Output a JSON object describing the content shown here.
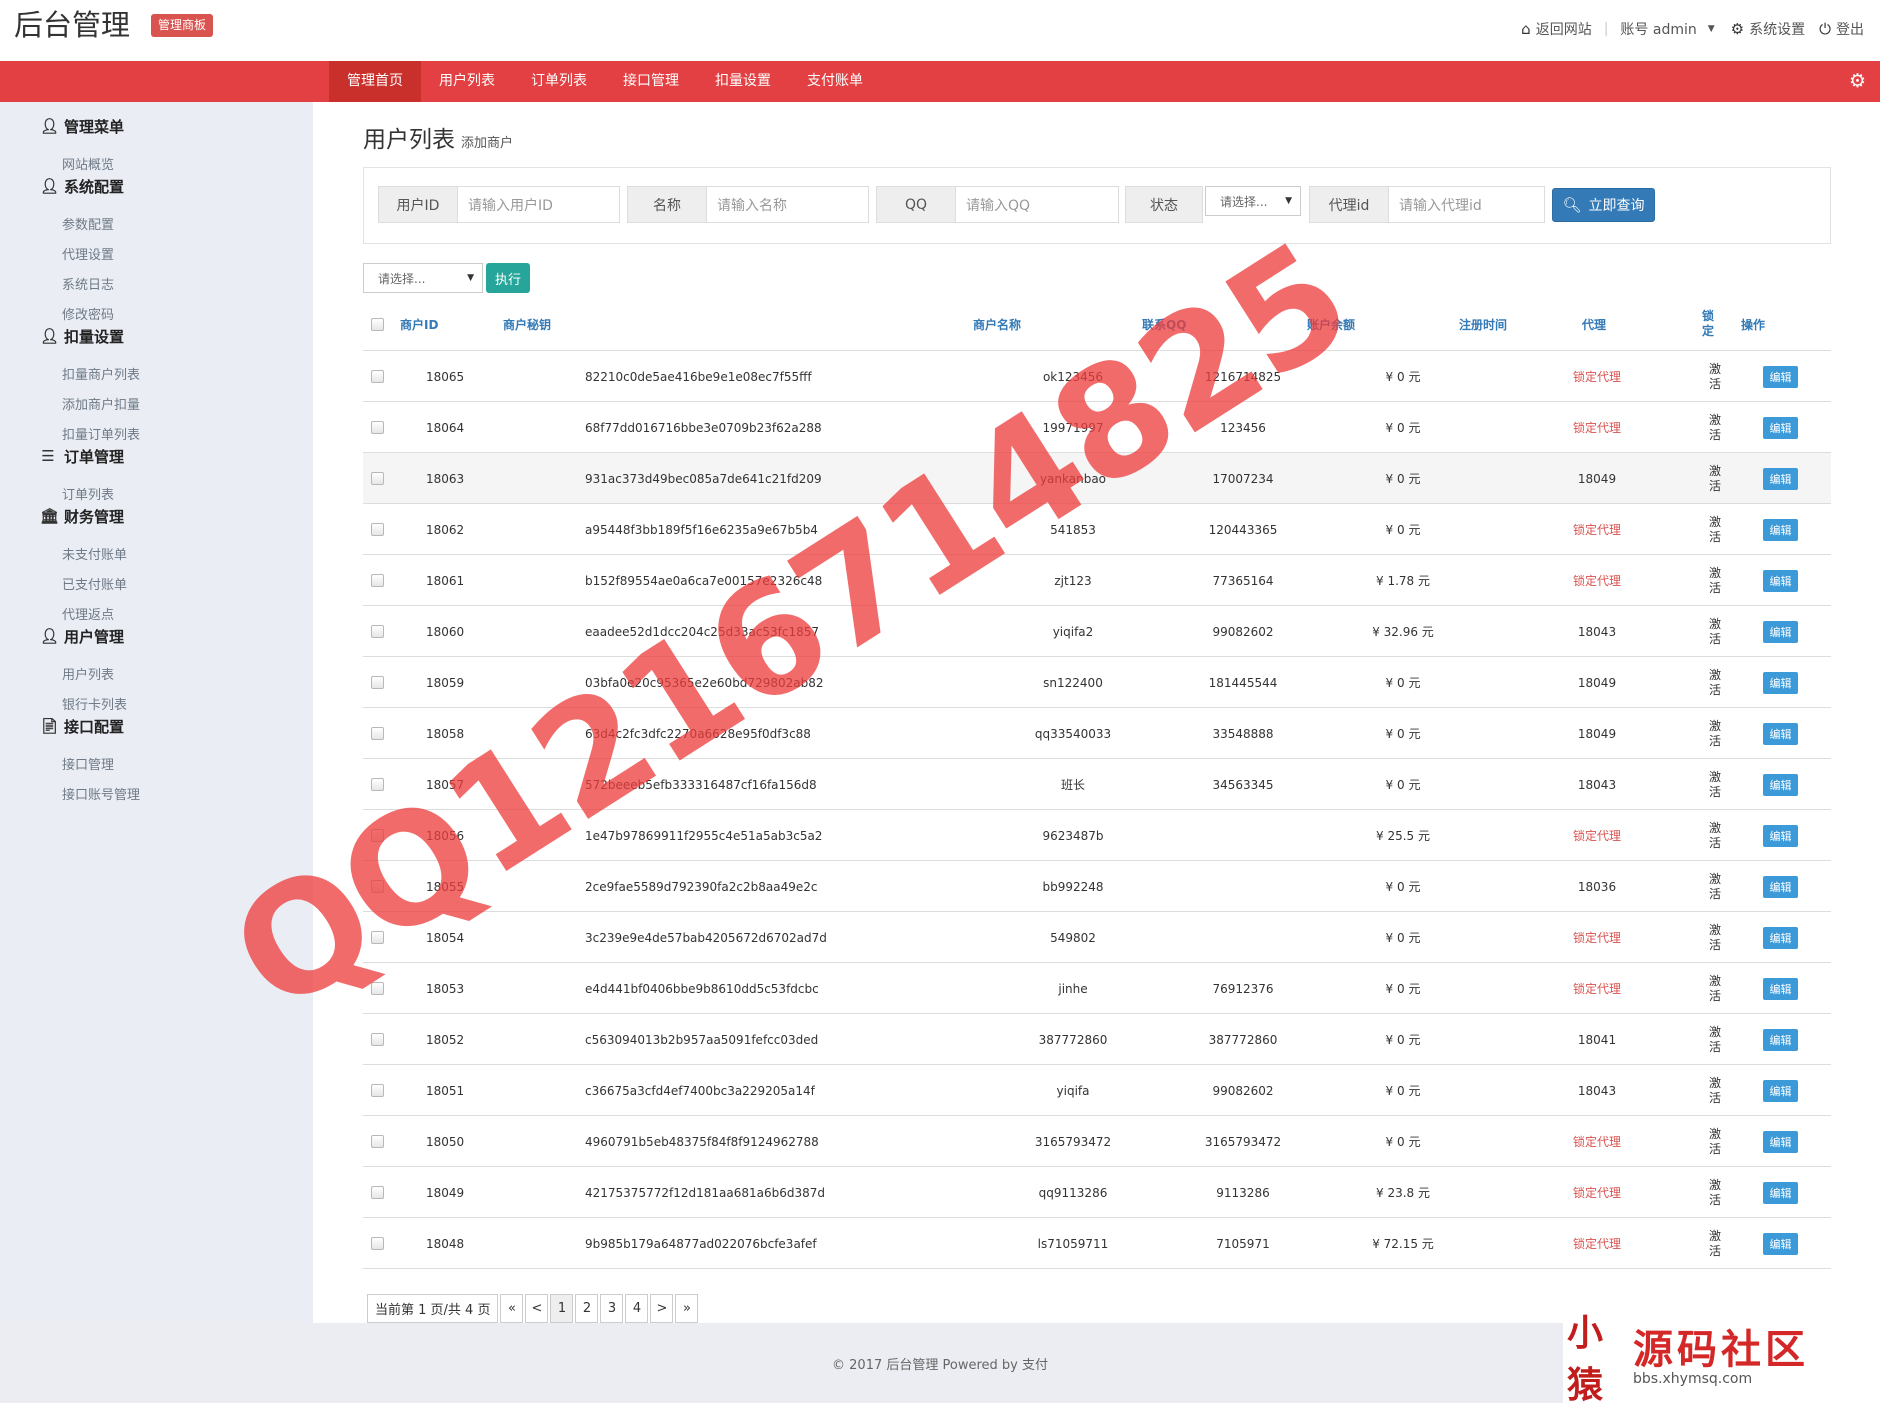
{
  "header": {
    "app_title": "后台管理",
    "badge": "管理商板",
    "links": {
      "back": "返回网站",
      "account": "账号 admin",
      "settings": "系统设置",
      "logout": "登出"
    }
  },
  "nav": {
    "tabs": [
      "管理首页",
      "用户列表",
      "订单列表",
      "接口管理",
      "扣量设置",
      "支付账单"
    ],
    "active_index": 0
  },
  "sidebar": {
    "groups": [
      {
        "title": "管理菜单",
        "icon": "user-icon",
        "items": [
          "网站概览"
        ]
      },
      {
        "title": "系统配置",
        "icon": "user-icon",
        "items": [
          "参数配置",
          "代理设置",
          "系统日志",
          "修改密码"
        ]
      },
      {
        "title": "扣量设置",
        "icon": "user-icon",
        "items": [
          "扣量商户列表",
          "添加商户扣量",
          "扣量订单列表"
        ]
      },
      {
        "title": "订单管理",
        "icon": "list-icon",
        "items": [
          "订单列表"
        ]
      },
      {
        "title": "财务管理",
        "icon": "bank-icon",
        "items": [
          "未支付账单",
          "已支付账单",
          "代理返点"
        ]
      },
      {
        "title": "用户管理",
        "icon": "user-icon",
        "items": [
          "用户列表",
          "银行卡列表"
        ]
      },
      {
        "title": "接口配置",
        "icon": "file-icon",
        "items": [
          "接口管理",
          "接口账号管理"
        ]
      }
    ]
  },
  "page": {
    "title": "用户列表",
    "subtitle": "添加商户"
  },
  "search": {
    "user_id": {
      "label": "用户ID",
      "placeholder": "请输入用户ID"
    },
    "name": {
      "label": "名称",
      "placeholder": "请输入名称"
    },
    "qq": {
      "label": "QQ",
      "placeholder": "请输入QQ"
    },
    "status": {
      "label": "状态",
      "value": "请选择..."
    },
    "agent_id": {
      "label": "代理id",
      "placeholder": "请输入代理id"
    },
    "button": "立即查询"
  },
  "bulk": {
    "select_value": "请选择...",
    "exec_label": "执行"
  },
  "table": {
    "columns": {
      "id": "商户ID",
      "key": "商户秘钥",
      "name": "商户名称",
      "qq": "联系QQ",
      "balance": "账户余额",
      "reg_time": "注册时间",
      "agent": "代理",
      "lock": "锁定",
      "op": "操作"
    },
    "rows": [
      {
        "id": "18065",
        "key": "82210c0de5ae416be9e1e08ec7f55fff",
        "name": "ok123456",
        "qq": "1216714825",
        "balance": "¥ 0 元",
        "agent": "锁定代理",
        "agent_locked": true,
        "status": "激活",
        "action": "编辑"
      },
      {
        "id": "18064",
        "key": "68f77dd016716bbe3e0709b23f62a288",
        "name": "19971997",
        "qq": "123456",
        "balance": "¥ 0 元",
        "agent": "锁定代理",
        "agent_locked": true,
        "status": "激活",
        "action": "编辑"
      },
      {
        "id": "18063",
        "key": "931ac373d49bec085a7de641c21fd209",
        "name": "yankanbao",
        "qq": "17007234",
        "balance": "¥ 0 元",
        "agent": "18049",
        "agent_locked": false,
        "status": "激活",
        "action": "编辑"
      },
      {
        "id": "18062",
        "key": "a95448f3bb189f5f16e6235a9e67b5b4",
        "name": "541853",
        "qq": "120443365",
        "balance": "¥ 0 元",
        "agent": "锁定代理",
        "agent_locked": true,
        "status": "激活",
        "action": "编辑"
      },
      {
        "id": "18061",
        "key": "b152f89554ae0a6ca7e00157e2326c48",
        "name": "zjt123",
        "qq": "77365164",
        "balance": "¥ 1.78 元",
        "agent": "锁定代理",
        "agent_locked": true,
        "status": "激活",
        "action": "编辑"
      },
      {
        "id": "18060",
        "key": "eaadee52d1dcc204c25d33ac53fc1857",
        "name": "yiqifa2",
        "qq": "99082602",
        "balance": "¥ 32.96 元",
        "agent": "18043",
        "agent_locked": false,
        "status": "激活",
        "action": "编辑"
      },
      {
        "id": "18059",
        "key": "03bfa0e20c95365e2e60bd729802ab82",
        "name": "sn122400",
        "qq": "181445544",
        "balance": "¥ 0 元",
        "agent": "18049",
        "agent_locked": false,
        "status": "激活",
        "action": "编辑"
      },
      {
        "id": "18058",
        "key": "63d4c2fc3dfc2270a6628e95f0df3c88",
        "name": "qq33540033",
        "qq": "33548888",
        "balance": "¥ 0 元",
        "agent": "18049",
        "agent_locked": false,
        "status": "激活",
        "action": "编辑"
      },
      {
        "id": "18057",
        "key": "572beeeb5efb333316487cf16fa156d8",
        "name": "班长",
        "qq": "34563345",
        "balance": "¥ 0 元",
        "agent": "18043",
        "agent_locked": false,
        "status": "激活",
        "action": "编辑"
      },
      {
        "id": "18056",
        "key": "1e47b97869911f2955c4e51a5ab3c5a2",
        "name": "9623487b",
        "qq": "",
        "balance": "¥ 25.5 元",
        "agent": "锁定代理",
        "agent_locked": true,
        "status": "激活",
        "action": "编辑"
      },
      {
        "id": "18055",
        "key": "2ce9fae5589d792390fa2c2b8aa49e2c",
        "name": "bb992248",
        "qq": "",
        "balance": "¥ 0 元",
        "agent": "18036",
        "agent_locked": false,
        "status": "激活",
        "action": "编辑"
      },
      {
        "id": "18054",
        "key": "3c239e9e4de57bab4205672d6702ad7d",
        "name": "549802",
        "qq": "",
        "balance": "¥ 0 元",
        "agent": "锁定代理",
        "agent_locked": true,
        "status": "激活",
        "action": "编辑"
      },
      {
        "id": "18053",
        "key": "e4d441bf0406bbe9b8610dd5c53fdcbc",
        "name": "jinhe",
        "qq": "76912376",
        "balance": "¥ 0 元",
        "agent": "锁定代理",
        "agent_locked": true,
        "status": "激活",
        "action": "编辑"
      },
      {
        "id": "18052",
        "key": "c563094013b2b957aa5091fefcc03ded",
        "name": "387772860",
        "qq": "387772860",
        "balance": "¥ 0 元",
        "agent": "18041",
        "agent_locked": false,
        "status": "激活",
        "action": "编辑"
      },
      {
        "id": "18051",
        "key": "c36675a3cfd4ef7400bc3a229205a14f",
        "name": "yiqifa",
        "qq": "99082602",
        "balance": "¥ 0 元",
        "agent": "18043",
        "agent_locked": false,
        "status": "激活",
        "action": "编辑"
      },
      {
        "id": "18050",
        "key": "4960791b5eb48375f84f8f9124962788",
        "name": "3165793472",
        "qq": "3165793472",
        "balance": "¥ 0 元",
        "agent": "锁定代理",
        "agent_locked": true,
        "status": "激活",
        "action": "编辑"
      },
      {
        "id": "18049",
        "key": "42175375772f12d181aa681a6b6d387d",
        "name": "qq9113286",
        "qq": "9113286",
        "balance": "¥ 23.8 元",
        "agent": "锁定代理",
        "agent_locked": true,
        "status": "激活",
        "action": "编辑"
      },
      {
        "id": "18048",
        "key": "9b985b179a64877ad022076bcfe3afef",
        "name": "ls71059711",
        "qq": "7105971",
        "balance": "¥ 72.15 元",
        "agent": "锁定代理",
        "agent_locked": true,
        "status": "激活",
        "action": "编辑"
      }
    ]
  },
  "pagination": {
    "info": "当前第 1 页/共 4 页",
    "first": "«",
    "prev": "<",
    "pages": [
      "1",
      "2",
      "3",
      "4"
    ],
    "current": "1",
    "next": ">",
    "last": "»"
  },
  "footer": {
    "text": "© 2017 后台管理 Powered by 支付"
  },
  "watermark": {
    "text": "QQ1216714825"
  },
  "brand": {
    "mark": "小猿",
    "name": "源码社区",
    "url": "bbs.xhymsq.com"
  },
  "colors": {
    "primary_red": "#e34043",
    "active_tab": "#c9302c",
    "link_blue": "#337ab7",
    "lock_red": "#d9534f",
    "edit_blue": "#3d9ad8",
    "exec_teal": "#26a69a",
    "sidebar_bg": "#eaedf4"
  }
}
